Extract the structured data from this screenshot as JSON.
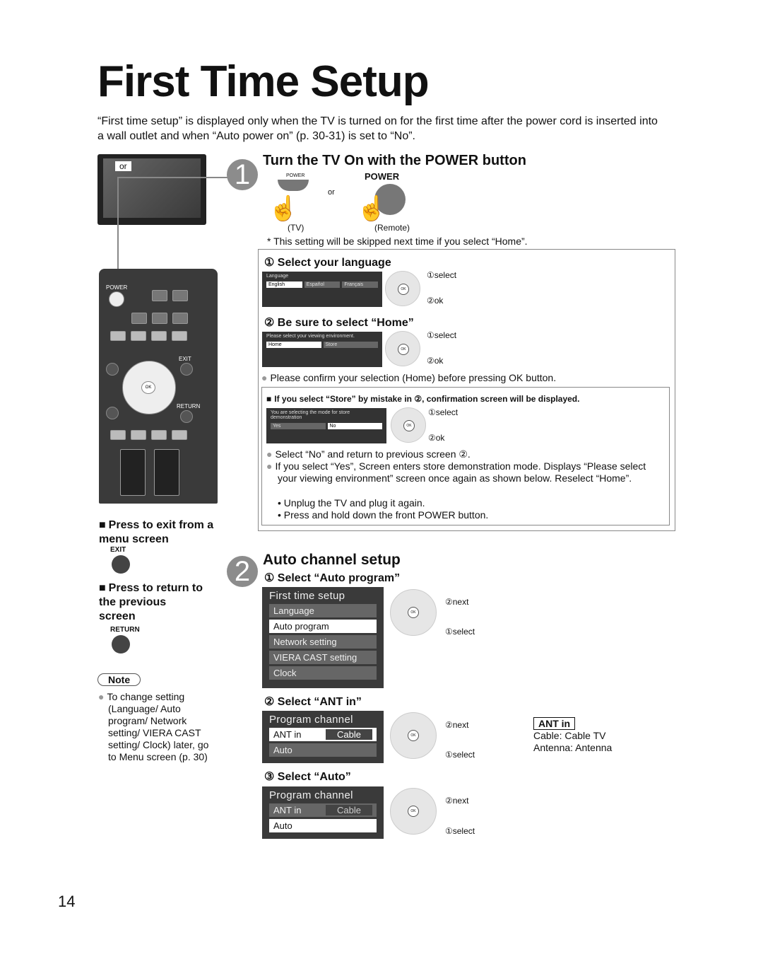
{
  "title": "First Time Setup",
  "intro": "“First time setup” is displayed only when the TV is turned on for the first time after the power cord is inserted into a wall outlet and when “Auto power on” (p. 30-31) is set to “No”.",
  "tv_or": "or",
  "step1": {
    "num": "1",
    "heading": "Turn the TV On with the POWER button",
    "tv_power": "POWER",
    "remote_power": "POWER",
    "or": "or",
    "tv_caption": "(TV)",
    "remote_caption": "(Remote)",
    "note": "* This setting will be skipped next time if you select “Home”.",
    "sub1": {
      "heading": "① Select your language",
      "screen_title": "Language",
      "options": [
        "English",
        "Español",
        "Français"
      ],
      "select": "①select",
      "ok": "②ok"
    },
    "sub2": {
      "heading": "② Be sure to select “Home”",
      "screen_title": "Please select your viewing environment.",
      "options": [
        "Home",
        "Store"
      ],
      "select": "①select",
      "ok": "②ok"
    },
    "confirm": "Please confirm your selection (Home) before pressing OK button.",
    "store": {
      "heading": "If you select “Store” by mistake in ②, confirmation screen will be displayed.",
      "screen_title": "You are selecting the mode for store demonstration",
      "options": [
        "Yes",
        "No"
      ],
      "select": "①select",
      "ok": "②ok",
      "bullet1": "Select “No” and return to previous screen ②.",
      "bullet2": "If you select “Yes”, Screen enters store demonstration mode. Displays “Please select your viewing environment” screen once again as shown below. Reselect “Home”.",
      "sub1": "• Unplug the TV and plug it again.",
      "sub2": "• Press and hold down the front POWER button."
    }
  },
  "remote": {
    "power": "POWER",
    "exit": "EXIT",
    "return": "RETURN",
    "ok": "OK"
  },
  "left": {
    "exit_heading": "Press to exit from a menu screen",
    "exit_label": "EXIT",
    "return_heading": "Press to return to the previous screen",
    "return_label": "RETURN",
    "note_label": "Note",
    "note_text": "To change setting (Language/ Auto program/ Network setting/ VIERA CAST setting/ Clock) later, go to Menu screen (p. 30)"
  },
  "step2": {
    "num": "2",
    "heading": "Auto channel setup",
    "sub1": {
      "heading": "① Select “Auto program”",
      "menu_title": "First time setup",
      "items": [
        "Language",
        "Auto program",
        "Network setting",
        "VIERA CAST setting",
        "Clock"
      ],
      "next": "②next",
      "select": "①select"
    },
    "sub2": {
      "heading": "② Select “ANT in”",
      "menu_title": "Program channel",
      "ant_label": "ANT in",
      "ant_value": "Cable",
      "auto": "Auto",
      "next": "②next",
      "select": "①select"
    },
    "sub3": {
      "heading": "③ Select “Auto”",
      "menu_title": "Program channel",
      "ant_label": "ANT in",
      "ant_value": "Cable",
      "auto": "Auto",
      "next": "②next",
      "select": "①select"
    },
    "ant_box": {
      "title": "ANT in",
      "cable": "Cable:  Cable TV",
      "antenna": "Antenna:  Antenna"
    }
  },
  "page_number": "14"
}
